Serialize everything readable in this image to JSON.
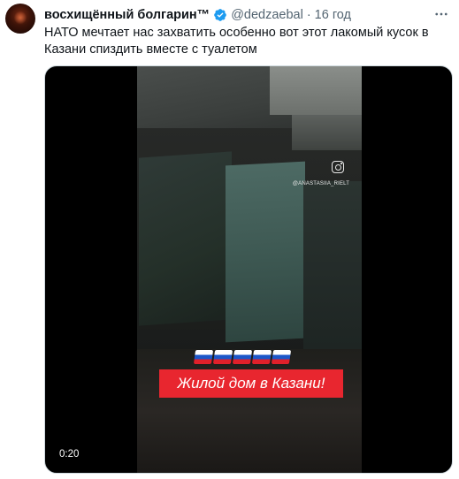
{
  "tweet": {
    "display_name": "восхищённый болгарин™",
    "handle": "@dedzaebal",
    "separator": "·",
    "time": "16 год",
    "text": "НАТО мечтает нас захватить особенно вот этот лакомый кусок в Казани спиздить вместе с туалетом",
    "more_icon": "more-horizontal-icon",
    "verified_color": "#1d9bf0"
  },
  "media": {
    "watermark_username": "@ANASTASIIA_RIELT",
    "flags_count": 5,
    "caption": "Жилой дом в Казани!",
    "caption_color": "#e8262f",
    "timestamp": "0:20"
  }
}
